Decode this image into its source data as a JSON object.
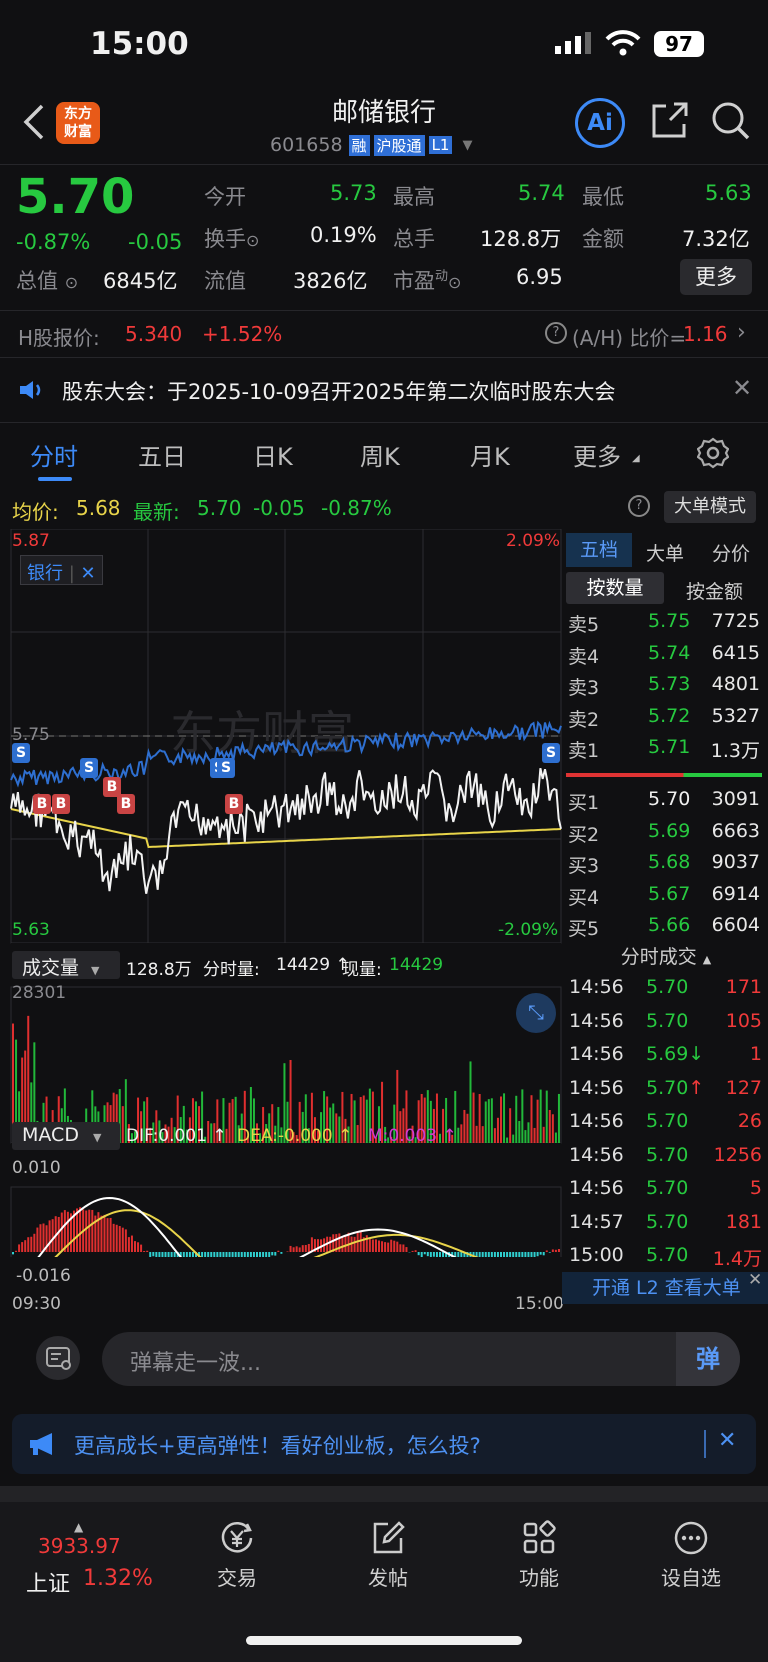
{
  "status": {
    "time": "15:00",
    "battery": "97"
  },
  "header": {
    "logo_line1": "东方",
    "logo_line2": "财富",
    "name": "邮储银行",
    "code": "601658",
    "tag_rong": "融",
    "tag_hgt": "沪股通",
    "tag_l1": "L1",
    "ai": "Ai"
  },
  "quote": {
    "price": "5.70",
    "pct": "-0.87%",
    "chg": "-0.05",
    "open_label": "今开",
    "open": "5.73",
    "high_label": "最高",
    "high": "5.74",
    "low_label": "最低",
    "low": "5.63",
    "turnover_label": "换手",
    "turnover": "0.19%",
    "volume_label": "总手",
    "volume": "128.8万",
    "amount_label": "金额",
    "amount": "7.32亿",
    "mcap_label": "总值",
    "mcap": "6845亿",
    "float_label": "流值",
    "float": "3826亿",
    "pe_label": "市盈",
    "pe_sup": "动",
    "pe": "6.95",
    "more": "更多"
  },
  "hshare": {
    "label": "H股报价:",
    "price": "5.340",
    "pct": "+1.52%",
    "ah_label": "(A/H) 比价=",
    "ah": "1.16"
  },
  "notice": {
    "text": "股东大会：于2025-10-09召开2025年第二次临时股东大会"
  },
  "tabs": [
    "分时",
    "五日",
    "日K",
    "周K",
    "月K",
    "更多"
  ],
  "avgline": {
    "avg_label": "均价:",
    "avg": "5.68",
    "last_label": "最新:",
    "last": "5.70",
    "chg": "-0.05",
    "pct": "-0.87%",
    "mode": "大单模式"
  },
  "chart": {
    "ymax": "5.87",
    "ymin": "5.63",
    "pmax": "2.09%",
    "pmin": "-2.09%",
    "ref": "5.75",
    "tag": "银行",
    "watermark": "东方财富",
    "t_start": "09:30",
    "t_end": "15:00"
  },
  "volbar": {
    "label": "成交量",
    "total": "128.8万",
    "fen_label": "分时量:",
    "fen": "14429 ↑",
    "now_label": "现量:",
    "now": "14429",
    "max": "28301"
  },
  "macd": {
    "label": "MACD",
    "dif": "DIF:0.001 ↑",
    "dea": "DEA:-0.000 ↑",
    "m": "M:0.003 ↑",
    "top": "0.010",
    "bottom": "-0.016"
  },
  "book_tabs": [
    "五档",
    "大单",
    "分价"
  ],
  "book_sub": [
    "按数量",
    "按金额"
  ],
  "sells": [
    [
      "卖5",
      "5.75",
      "7725"
    ],
    [
      "卖4",
      "5.74",
      "6415"
    ],
    [
      "卖3",
      "5.73",
      "4801"
    ],
    [
      "卖2",
      "5.72",
      "5327"
    ],
    [
      "卖1",
      "5.71",
      "1.3万"
    ]
  ],
  "buys": [
    [
      "买1",
      "5.70",
      "3091"
    ],
    [
      "买2",
      "5.69",
      "6663"
    ],
    [
      "买3",
      "5.68",
      "9037"
    ],
    [
      "买4",
      "5.67",
      "6914"
    ],
    [
      "买5",
      "5.66",
      "6604"
    ]
  ],
  "ticks_title": "分时成交",
  "ticks": [
    [
      "14:56",
      "5.70",
      "171"
    ],
    [
      "14:56",
      "5.70",
      "105"
    ],
    [
      "14:56",
      "5.69↓",
      "1"
    ],
    [
      "14:56",
      "5.70↑",
      "127"
    ],
    [
      "14:56",
      "5.70",
      "26"
    ],
    [
      "14:56",
      "5.70",
      "1256"
    ],
    [
      "14:56",
      "5.70",
      "5"
    ],
    [
      "14:57",
      "5.70",
      "181"
    ],
    [
      "15:00",
      "5.70",
      "1.4万"
    ]
  ],
  "l2": "开通 L2 查看大单",
  "danmu": {
    "placeholder": "弹幕走一波...",
    "btn": "弹"
  },
  "ad": {
    "text": "更高成长+更高弹性！看好创业板，怎么投?"
  },
  "bottom": {
    "index": "3933.97",
    "index_name": "上证",
    "index_pct": "1.32%",
    "trade": "交易",
    "post": "发帖",
    "func": "功能",
    "fav": "设自选"
  },
  "colors": {
    "up": "#f03a3a",
    "down": "#27c940",
    "accent": "#3d8af7",
    "avg": "#e8d44a"
  }
}
